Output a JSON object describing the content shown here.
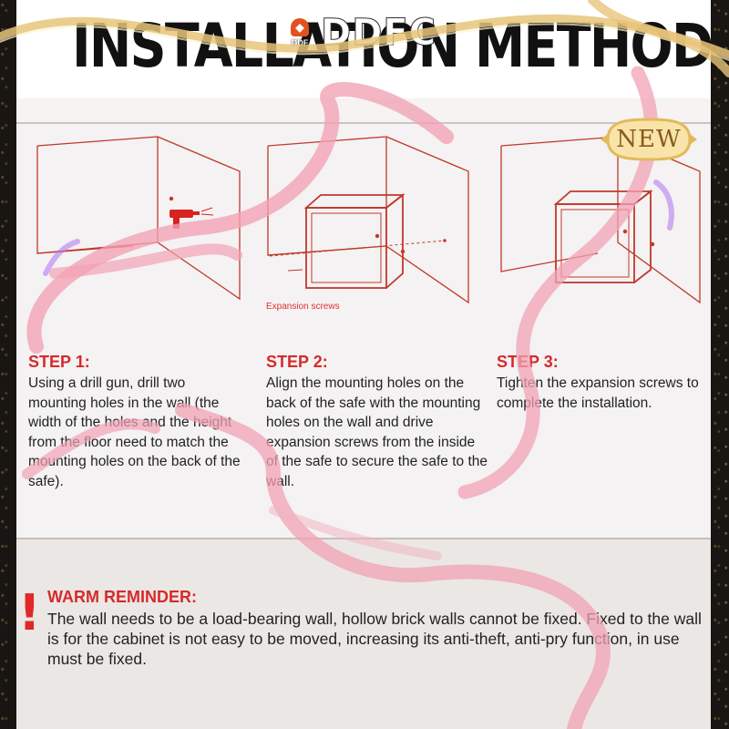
{
  "header": {
    "title": "INSTALLATION METHOD",
    "logo_badge_text": "DDF",
    "logo_text": "DDFC"
  },
  "badge": {
    "label": "NEW"
  },
  "diagrams": {
    "caption": "Expansion screws"
  },
  "steps": [
    {
      "title": "STEP 1:",
      "body": "Using a drill gun, drill two mounting holes in the wall (the width of the holes and the height from the floor need to match the mounting holes on the back of the safe)."
    },
    {
      "title": "STEP 2:",
      "body": "Align the mounting holes on the back of the safe with the mounting holes on the wall and drive expansion screws from the inside of the safe to secure the safe to the wall."
    },
    {
      "title": "STEP 3:",
      "body": "Tighten the expansion screws to complete the installation."
    }
  ],
  "reminder": {
    "icon": "exclamation-icon",
    "title": "WARM REMINDER:",
    "body": "The wall needs to be a load-bearing wall, hollow brick walls cannot be fixed. Fixed to the wall is for the cabinet is not easy to be moved, increasing its anti-theft, anti-pry function, in use must be fixed."
  },
  "colors": {
    "accent_red": "#d62a2a",
    "ribbon_pink": "#f0a3b3",
    "gold": "#e8c47a"
  }
}
